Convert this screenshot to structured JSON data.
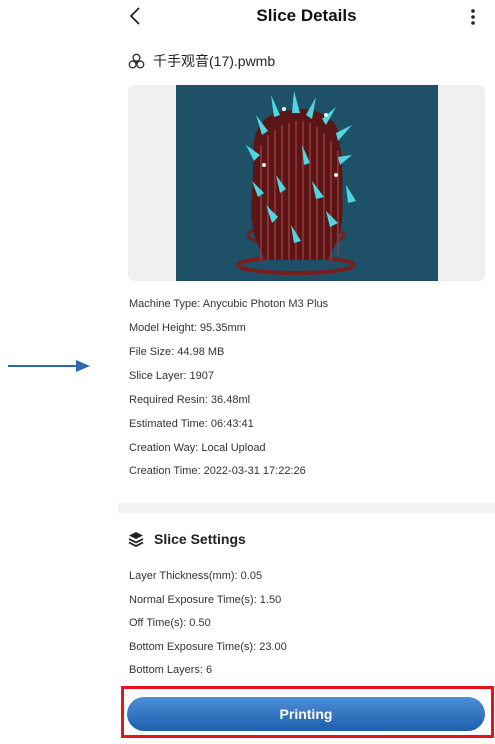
{
  "header": {
    "title": "Slice Details"
  },
  "file": {
    "name": "千手观音(17).pwmb"
  },
  "details": [
    "Machine Type: Anycubic Photon M3 Plus",
    "Model Height: 95.35mm",
    "File Size: 44.98 MB",
    "Slice Layer: 1907",
    "Required Resin: 36.48ml",
    "Estimated Time: 06:43:41",
    "Creation Way: Local Upload",
    "Creation Time: 2022-03-31 17:22:26"
  ],
  "slice_settings": {
    "title": "Slice Settings",
    "items": [
      "Layer Thickness(mm): 0.05",
      "Normal Exposure Time(s): 1.50",
      "Off Time(s): 0.50",
      "Bottom Exposure Time(s): 23.00",
      "Bottom Layers: 6"
    ]
  },
  "action": {
    "label": "Printing"
  },
  "colors": {
    "accent": "#2f72c2",
    "highlight_frame": "#e8121c",
    "preview_background": "#1e5068",
    "model_cyan": "#4fd6e0",
    "model_red": "#7a1d1d"
  },
  "icons": {
    "back": "chevron-left-icon",
    "more": "more-vertical-icon",
    "file": "biohazard-icon",
    "settings": "layers-icon",
    "annotation": "arrow-right-icon"
  }
}
